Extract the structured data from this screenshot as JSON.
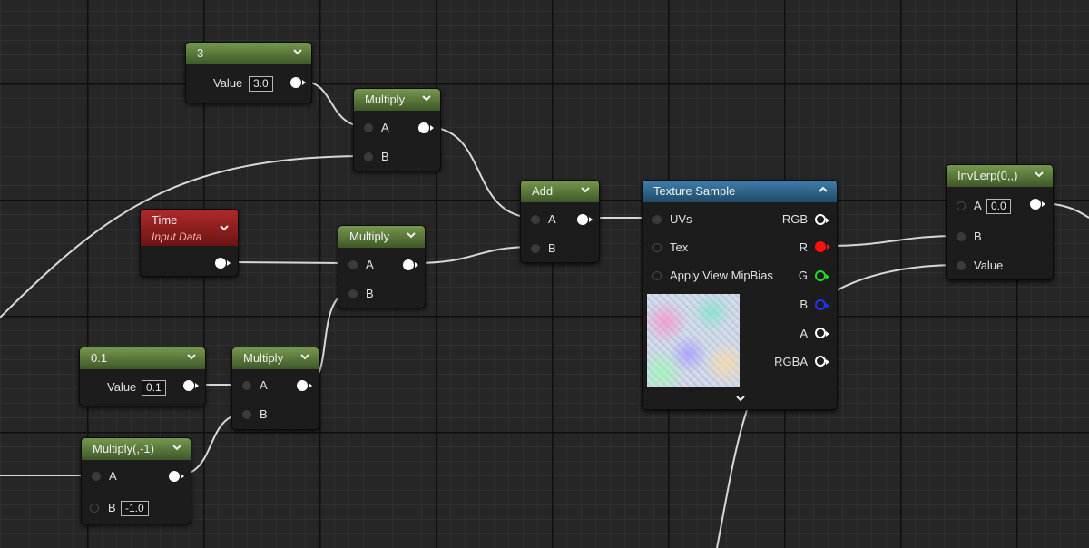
{
  "nodes": {
    "const3": {
      "title": "3",
      "value_label": "Value",
      "value": "3.0"
    },
    "multiply1": {
      "title": "Multiply",
      "pin_a": "A",
      "pin_b": "B"
    },
    "time": {
      "title": "Time",
      "subtitle": "Input Data"
    },
    "multiply2": {
      "title": "Multiply",
      "pin_a": "A",
      "pin_b": "B"
    },
    "add": {
      "title": "Add",
      "pin_a": "A",
      "pin_b": "B"
    },
    "texture_sample": {
      "title": "Texture Sample",
      "inputs": [
        "UVs",
        "Tex",
        "Apply View MipBias"
      ],
      "outputs": [
        "RGB",
        "R",
        "G",
        "B",
        "A",
        "RGBA"
      ]
    },
    "invlerp": {
      "title": "InvLerp(0,,)",
      "pin_a": "A",
      "pin_a_value": "0.0",
      "pin_b": "B",
      "pin_value": "Value"
    },
    "const01": {
      "title": "0.1",
      "value_label": "Value",
      "value": "0.1"
    },
    "multiply3": {
      "title": "Multiply",
      "pin_a": "A",
      "pin_b": "B"
    },
    "multiply_neg": {
      "title": "Multiply(,-1)",
      "pin_a": "A",
      "pin_b": "B",
      "pin_b_value": "-1.0"
    }
  },
  "pin_colors": {
    "r": "#ff1010",
    "g": "#22dd22",
    "b": "#2233ff",
    "a": "#ffffff",
    "rgb": "#ffffff",
    "rgba": "#ffffff"
  },
  "icons": {
    "collapse": "chevron-down-icon",
    "expand_up": "chevron-up-icon",
    "preview_expand": "chevron-down-icon"
  }
}
